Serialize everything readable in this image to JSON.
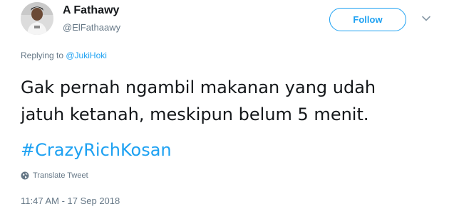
{
  "user": {
    "display_name": "A Fathawy",
    "handle": "@ElFathaawy",
    "avatar_icon": "user-photo"
  },
  "follow": {
    "label": "Follow",
    "accent": "#1da1f2"
  },
  "reply": {
    "prefix": "Replying to ",
    "mention": "@JukiHoki"
  },
  "tweet": {
    "lines": [
      "Gak pernah ngambil makanan yang udah",
      "jatuh ketanah, meskipun belum 5 menit."
    ],
    "hashtag": "#CrazyRichKosan"
  },
  "translate": {
    "label": "Translate Tweet",
    "icon": "globe-icon"
  },
  "timestamp": "11:47 AM - 17 Sep 2018",
  "colors": {
    "text": "#14171a",
    "secondary": "#657786",
    "link": "#1da1f2"
  }
}
